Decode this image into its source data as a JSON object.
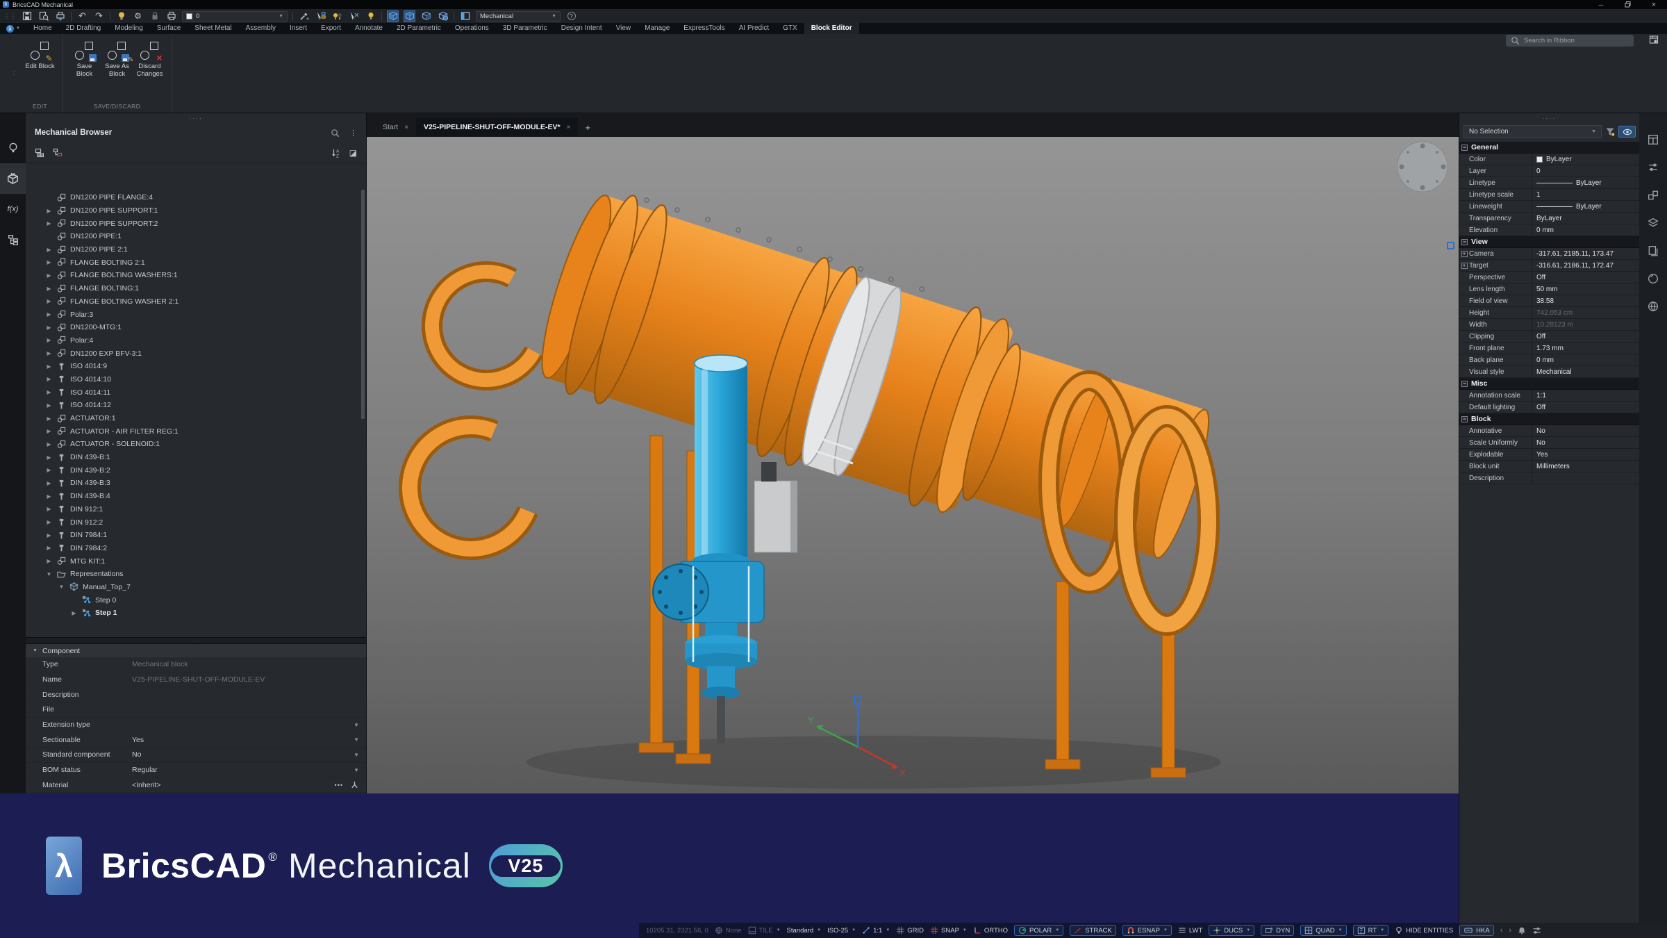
{
  "colors": {
    "accent": "#3f8cda",
    "orange": "#e8831c",
    "cyan": "#2aa4d8",
    "navy": "#1c1d52",
    "active_tool": "#2a4f79"
  },
  "window": {
    "title": "BricsCAD Mechanical",
    "logo_glyph": "λ",
    "controls": [
      "minimize-icon",
      "restore-icon",
      "close-icon"
    ]
  },
  "qat": {
    "items": [
      {
        "icon": "grip-icon"
      },
      {
        "icon": "save-icon"
      },
      {
        "icon": "preview-icon"
      },
      {
        "icon": "publish-icon"
      },
      {
        "sep": true
      },
      {
        "icon": "undo-icon"
      },
      {
        "icon": "redo-icon"
      },
      {
        "sep": true
      },
      {
        "icon": "bulb-on-icon"
      },
      {
        "icon": "gear-icon"
      },
      {
        "icon": "lock-icon"
      },
      {
        "icon": "print-icon"
      },
      {
        "combo": "0",
        "width": 152,
        "swatch": "#f0f0f0"
      },
      {
        "sep": true
      },
      {
        "icon": "dropper-icon"
      },
      {
        "icon": "cursor-box-icon"
      },
      {
        "icon": "bulb-pair-icon"
      },
      {
        "icon": "cursor-cross-icon"
      },
      {
        "icon": "bulb-select-icon"
      },
      {
        "sep": true
      },
      {
        "icon": "cube-front-icon",
        "active": true
      },
      {
        "icon": "cube-iso-icon",
        "active": true
      },
      {
        "icon": "cube-section-icon"
      },
      {
        "icon": "cube-world-icon"
      },
      {
        "sep": true
      },
      {
        "icon": "panel-toggle-icon"
      },
      {
        "combo": "Mechanical",
        "width": 122
      },
      {
        "icon": "help-icon"
      }
    ]
  },
  "ribbon": {
    "search_placeholder": "Search in Ribbon",
    "tabs": [
      {
        "label": "Home"
      },
      {
        "label": "2D Drafting"
      },
      {
        "label": "Modeling"
      },
      {
        "label": "Surface"
      },
      {
        "label": "Sheet Metal"
      },
      {
        "label": "Assembly"
      },
      {
        "label": "Insert"
      },
      {
        "label": "Export"
      },
      {
        "label": "Annotate"
      },
      {
        "label": "2D Parametric"
      },
      {
        "label": "Operations"
      },
      {
        "label": "3D Parametric"
      },
      {
        "label": "Design Intent"
      },
      {
        "label": "View"
      },
      {
        "label": "Manage"
      },
      {
        "label": "ExpressTools"
      },
      {
        "label": "AI Predict"
      },
      {
        "label": "GTX"
      },
      {
        "label": "Block Editor",
        "active": true
      }
    ],
    "groups": [
      {
        "label": "EDIT",
        "buttons": [
          {
            "label": "Edit Block",
            "icon": "edit-block-icon"
          }
        ]
      },
      {
        "label": "SAVE/DISCARD",
        "buttons": [
          {
            "label": "Save Block",
            "icon": "save-block-icon"
          },
          {
            "label": "Save As Block",
            "icon": "saveas-block-icon"
          },
          {
            "label": "Discard Changes",
            "icon": "discard-block-icon"
          }
        ]
      }
    ]
  },
  "doc_tabs": {
    "tabs": [
      {
        "label": "Start"
      },
      {
        "label": "V25-PIPELINE-SHUT-OFF-MODULE-EV*",
        "active": true
      }
    ],
    "new_tab_label": "+"
  },
  "left_strip": {
    "icons": [
      {
        "name": "lamp-icon"
      },
      {
        "name": "solid-box-icon",
        "active": true
      },
      {
        "name": "fx-icon",
        "label": "f(x)"
      },
      {
        "name": "structure-icon"
      }
    ]
  },
  "browser": {
    "title": "Mechanical Browser",
    "header_icons": [
      "search-icon",
      "kebab-icon"
    ],
    "toolbar_left": [
      "insert-block-icon",
      "replace-block-icon"
    ],
    "toolbar_right": [
      "sort-icon",
      "display-mode-icon"
    ],
    "tree": [
      {
        "label": "DN1200 PIPE FLANGE:4",
        "icon": "block",
        "arrow": "none"
      },
      {
        "label": "DN1200 PIPE SUPPORT:1",
        "icon": "block",
        "arrow": "closed"
      },
      {
        "label": "DN1200 PIPE SUPPORT:2",
        "icon": "block",
        "arrow": "closed"
      },
      {
        "label": "DN1200 PIPE:1",
        "icon": "block",
        "arrow": "none"
      },
      {
        "label": "DN1200 PIPE 2:1",
        "icon": "block",
        "arrow": "closed"
      },
      {
        "label": "FLANGE  BOLTING 2:1",
        "icon": "block",
        "arrow": "closed"
      },
      {
        "label": "FLANGE BOLTING WASHERS:1",
        "icon": "block",
        "arrow": "closed"
      },
      {
        "label": "FLANGE BOLTING:1",
        "icon": "block",
        "arrow": "closed"
      },
      {
        "label": "FLANGE BOLTING WASHER 2:1",
        "icon": "block",
        "arrow": "closed"
      },
      {
        "label": "Polar:3",
        "icon": "block",
        "arrow": "closed"
      },
      {
        "label": "DN1200-MTG:1",
        "icon": "block",
        "arrow": "closed"
      },
      {
        "label": "Polar:4",
        "icon": "block",
        "arrow": "closed"
      },
      {
        "label": "DN1200 EXP BFV-3:1",
        "icon": "block",
        "arrow": "closed"
      },
      {
        "label": "ISO 4014:9",
        "icon": "bolt",
        "arrow": "closed"
      },
      {
        "label": "ISO 4014:10",
        "icon": "bolt",
        "arrow": "closed"
      },
      {
        "label": "ISO 4014:11",
        "icon": "bolt",
        "arrow": "closed"
      },
      {
        "label": "ISO 4014:12",
        "icon": "bolt",
        "arrow": "closed"
      },
      {
        "label": "ACTUATOR:1",
        "icon": "block",
        "arrow": "closed"
      },
      {
        "label": "ACTUATOR - AIR FILTER REG:1",
        "icon": "block",
        "arrow": "closed"
      },
      {
        "label": "ACTUATOR - SOLENOID:1",
        "icon": "block",
        "arrow": "closed"
      },
      {
        "label": "DIN 439-B:1",
        "icon": "bolt",
        "arrow": "closed"
      },
      {
        "label": "DIN 439-B:2",
        "icon": "bolt",
        "arrow": "closed"
      },
      {
        "label": "DIN 439-B:3",
        "icon": "bolt",
        "arrow": "closed"
      },
      {
        "label": "DIN 439-B:4",
        "icon": "bolt",
        "arrow": "closed"
      },
      {
        "label": "DIN 912:1",
        "icon": "bolt",
        "arrow": "closed"
      },
      {
        "label": "DIN 912:2",
        "icon": "bolt",
        "arrow": "closed"
      },
      {
        "label": "DIN 7984:1",
        "icon": "bolt",
        "arrow": "closed"
      },
      {
        "label": "DIN 7984:2",
        "icon": "bolt",
        "arrow": "closed"
      },
      {
        "label": "MTG KIT:1",
        "icon": "block",
        "arrow": "closed"
      },
      {
        "label": "Representations",
        "icon": "folder",
        "arrow": "open"
      },
      {
        "label": "Manual_Top_7",
        "icon": "cube",
        "arrow": "open",
        "indent": 1
      },
      {
        "label": "Step 0",
        "icon": "steps",
        "arrow": "none",
        "indent": 2
      },
      {
        "label": "Step 1",
        "icon": "steps",
        "arrow": "closed",
        "indent": 2,
        "bold": true
      }
    ]
  },
  "component": {
    "title": "Component",
    "rows": [
      {
        "label": "Type",
        "value": "Mechanical block",
        "muted": true
      },
      {
        "label": "Name",
        "value": "V25-PIPELINE-SHUT-OFF-MODULE-EV",
        "muted": true
      },
      {
        "label": "Description",
        "value": ""
      },
      {
        "label": "File",
        "value": ""
      },
      {
        "label": "Extension type",
        "value": "",
        "dropdown": true
      },
      {
        "label": "Sectionable",
        "value": "Yes",
        "dropdown": true
      },
      {
        "label": "Standard component",
        "value": "No",
        "dropdown": true
      },
      {
        "label": "BOM status",
        "value": "Regular",
        "dropdown": true
      },
      {
        "label": "Material",
        "value": "<Inherit>",
        "icons": [
          "ellipsis-icon",
          "material-icon"
        ]
      }
    ]
  },
  "properties": {
    "selector": "No Selection",
    "header_icons": [
      "filter-icon",
      "eye-icon"
    ],
    "sections": [
      {
        "title": "General",
        "rows": [
          {
            "label": "Color",
            "value": "ByLayer",
            "swatch": "#ececec"
          },
          {
            "label": "Layer",
            "value": "0"
          },
          {
            "label": "Linetype",
            "value": "ByLayer",
            "line": true
          },
          {
            "label": "Linetype scale",
            "value": "1"
          },
          {
            "label": "Lineweight",
            "value": "ByLayer",
            "line": true
          },
          {
            "label": "Transparency",
            "value": "ByLayer"
          },
          {
            "label": "Elevation",
            "value": "0 mm"
          }
        ]
      },
      {
        "title": "View",
        "rows": [
          {
            "label": "Camera",
            "value": "-317.61, 2185.11, 173.47",
            "plus": true
          },
          {
            "label": "Target",
            "value": "-316.61, 2186.11, 172.47",
            "plus": true
          },
          {
            "label": "Perspective",
            "value": "Off"
          },
          {
            "label": "Lens length",
            "value": "50 mm"
          },
          {
            "label": "Field of view",
            "value": "38.58"
          },
          {
            "label": "Height",
            "value": "742.053 cm",
            "muted": true
          },
          {
            "label": "Width",
            "value": "10.28123 m",
            "muted": true
          },
          {
            "label": "Clipping",
            "value": "Off"
          },
          {
            "label": "Front plane",
            "value": "1.73 mm"
          },
          {
            "label": "Back plane",
            "value": "0 mm"
          },
          {
            "label": "Visual style",
            "value": "Mechanical"
          }
        ]
      },
      {
        "title": "Misc",
        "rows": [
          {
            "label": "Annotation scale",
            "value": "1:1"
          },
          {
            "label": "Default lighting",
            "value": "Off"
          }
        ]
      },
      {
        "title": "Block",
        "rows": [
          {
            "label": "Annotative",
            "value": "No"
          },
          {
            "label": "Scale Uniformly",
            "value": "No"
          },
          {
            "label": "Explodable",
            "value": "Yes"
          },
          {
            "label": "Block unit",
            "value": "Millimeters"
          },
          {
            "label": "Description",
            "value": ""
          }
        ]
      }
    ]
  },
  "right_strip": {
    "icons": [
      "panels-icon",
      "tools-icon",
      "blocks-icon",
      "layers-icon",
      "sheets-icon",
      "materials-icon",
      "world-icon"
    ]
  },
  "viewport": {
    "ucs": {
      "x": "X",
      "y": "Y"
    }
  },
  "statusbar": {
    "items": [
      {
        "label": "10205.31, 2321.56, 0",
        "muted": true
      },
      {
        "icon": "globe-icon",
        "label": "None",
        "muted": true
      },
      {
        "icon": "tile-icon",
        "label": "TILE",
        "dropdown": true,
        "muted": true
      },
      {
        "label": "Standard",
        "dropdown": true
      },
      {
        "label": "ISO-25",
        "dropdown": true
      },
      {
        "icon": "scale-icon",
        "label": "1:1",
        "dropdown": true
      },
      {
        "icon": "grid-icon",
        "label": "GRID"
      },
      {
        "icon": "snap-icon",
        "label": "SNAP",
        "dropdown": true
      },
      {
        "icon": "ortho-icon",
        "label": "ORTHO"
      },
      {
        "icon": "polar-icon",
        "label": "POLAR",
        "boxed": true,
        "dropdown": true
      },
      {
        "icon": "strack-icon",
        "label": "STRACK",
        "boxed": true
      },
      {
        "icon": "esnap-icon",
        "label": "ESNAP",
        "boxed": true,
        "dropdown": true
      },
      {
        "icon": "lwt-icon",
        "label": "LWT"
      },
      {
        "icon": "ducs-icon",
        "label": "DUCS",
        "boxed": true,
        "dropdown": true
      },
      {
        "icon": "dyn-icon",
        "label": "DYN",
        "boxed": true
      },
      {
        "icon": "quad-icon",
        "label": "QUAD",
        "boxed": true,
        "dropdown": true
      },
      {
        "icon": "rt-icon",
        "label": "RT",
        "boxed": true,
        "dropdown": true
      },
      {
        "icon": "bulb-icon",
        "label": "HIDE ENTITIES"
      },
      {
        "icon": "ctrl-key-icon",
        "label": "HKA",
        "boxed": true
      },
      {
        "icon": "chevron-left-icon"
      },
      {
        "icon": "chevron-right-icon"
      },
      {
        "icon": "bell-icon"
      },
      {
        "icon": "sliders-icon"
      }
    ]
  },
  "banner": {
    "brand": "BricsCAD",
    "reg": "®",
    "product": "Mechanical",
    "version": "V25"
  }
}
